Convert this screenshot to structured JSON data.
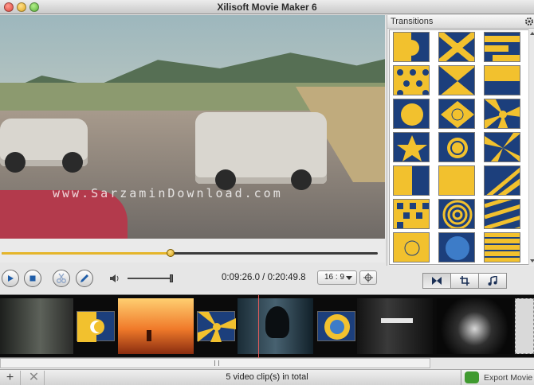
{
  "window": {
    "title": "Xilisoft Movie Maker 6"
  },
  "preview": {
    "watermark": "www.SarzaminDownload.com",
    "progress": 0.45
  },
  "player": {
    "current_time": "0:09:26.0",
    "separator": "/",
    "total_time": "0:20:49.8",
    "volume": 1.0,
    "aspect_ratio": "16 : 9"
  },
  "transitions": {
    "title": "Transitions",
    "tile_count": 21
  },
  "timeline": {
    "status": "5 video clip(s) in total"
  },
  "bottom": {
    "add_label": "+",
    "remove_label": "✕",
    "export_label": "Export Movie"
  },
  "colors": {
    "transition_blue": "#1c3f7c",
    "transition_yellow": "#f2c12e",
    "playhead": "#e25a5a",
    "seek_fill": "#e5b52a"
  },
  "icons": [
    "play-icon",
    "stop-icon",
    "scissors-icon",
    "pencil-icon",
    "volume-icon",
    "crosshair-icon",
    "gear-icon",
    "transition-tab-icon",
    "crop-icon",
    "music-icon"
  ]
}
